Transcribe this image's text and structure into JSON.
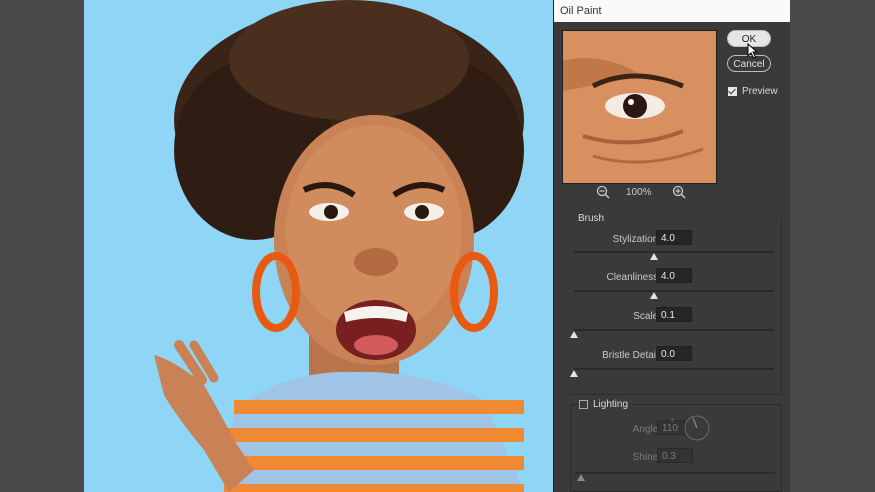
{
  "dialog": {
    "title": "Oil Paint",
    "ok_label": "OK",
    "cancel_label": "Cancel",
    "preview_label": "Preview",
    "preview_checked": true,
    "zoom_level": "100%"
  },
  "brush": {
    "title": "Brush",
    "stylization": {
      "label": "Stylization:",
      "value": "4.0",
      "level": 0.4
    },
    "cleanliness": {
      "label": "Cleanliness:",
      "value": "4.0",
      "level": 0.4
    },
    "scale": {
      "label": "Scale:",
      "value": "0.1",
      "level": 0.0
    },
    "bristle": {
      "label": "Bristle Detail:",
      "value": "0.0",
      "level": 0.0
    }
  },
  "lighting": {
    "title": "Lighting",
    "enabled": false,
    "angle": {
      "label": "Angle:",
      "value": "110",
      "unit": "°"
    },
    "shine": {
      "label": "Shine:",
      "value": "0.3",
      "level": 0.03
    }
  },
  "colors": {
    "canvas_bg": "#8fd6f6",
    "dialog_bg": "#3a3a3a",
    "workspace_bg": "#4a4a4a"
  }
}
